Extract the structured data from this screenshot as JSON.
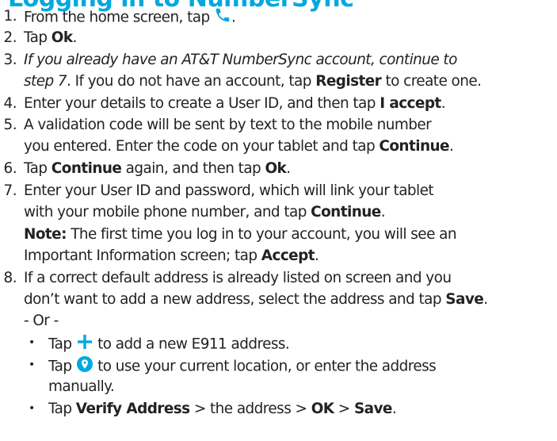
{
  "heading": "Logging in to NumberSync",
  "colors": {
    "accent": "#00a8e0",
    "text": "#222222"
  },
  "icons": {
    "phone": "phone-icon",
    "plus": "plus-icon",
    "location": "location-pin-icon"
  },
  "steps": [
    {
      "n": "1.",
      "a": "From the home screen, tap ",
      "b": "."
    },
    {
      "n": "2.",
      "a": "Tap ",
      "b": "Ok",
      "c": "."
    },
    {
      "n": "3.",
      "a": "If you already have an AT&T NumberSync account, continue to",
      "b": "step 7",
      "c": ". If you do not have an account, tap ",
      "d": "Register",
      "e": " to create one."
    },
    {
      "n": "4.",
      "a": "Enter your details to create a User ID, and then tap ",
      "b": "I accept",
      "c": "."
    },
    {
      "n": "5.",
      "a": "A validation code will be sent by text to the mobile number",
      "b": "you entered. Enter the code on your tablet and tap ",
      "c": "Continue",
      "d": "."
    },
    {
      "n": "6.",
      "a": "Tap ",
      "b": "Continue",
      "c": " again, and then tap ",
      "d": "Ok",
      "e": "."
    },
    {
      "n": "7.",
      "a": "Enter your User ID and password, which will link your tablet",
      "b": "with your mobile phone number, and tap ",
      "c": "Continue",
      "d": ".",
      "note_label": "Note:",
      "note_a": " The first time you log in to your account, you will see an",
      "note_b": "Important Information screen; tap ",
      "note_c": "Accept",
      "note_d": "."
    },
    {
      "n": "8.",
      "a": "If a correct default address is already listed on screen and you",
      "b": "don’t want to add a new address, select the address and tap ",
      "c": "Save",
      "d": ".",
      "or": "- Or -"
    }
  ],
  "bullets": [
    {
      "a": "Tap ",
      "b": " to add a new E911 address."
    },
    {
      "a": "Tap ",
      "b": " to use your current location, or enter the address",
      "c": "manually."
    },
    {
      "a": "Tap ",
      "b": "Verify Address",
      "c": " > the address > ",
      "d": "OK",
      "e": " > ",
      "f": "Save",
      "g": "."
    }
  ],
  "bullet_char": "•"
}
